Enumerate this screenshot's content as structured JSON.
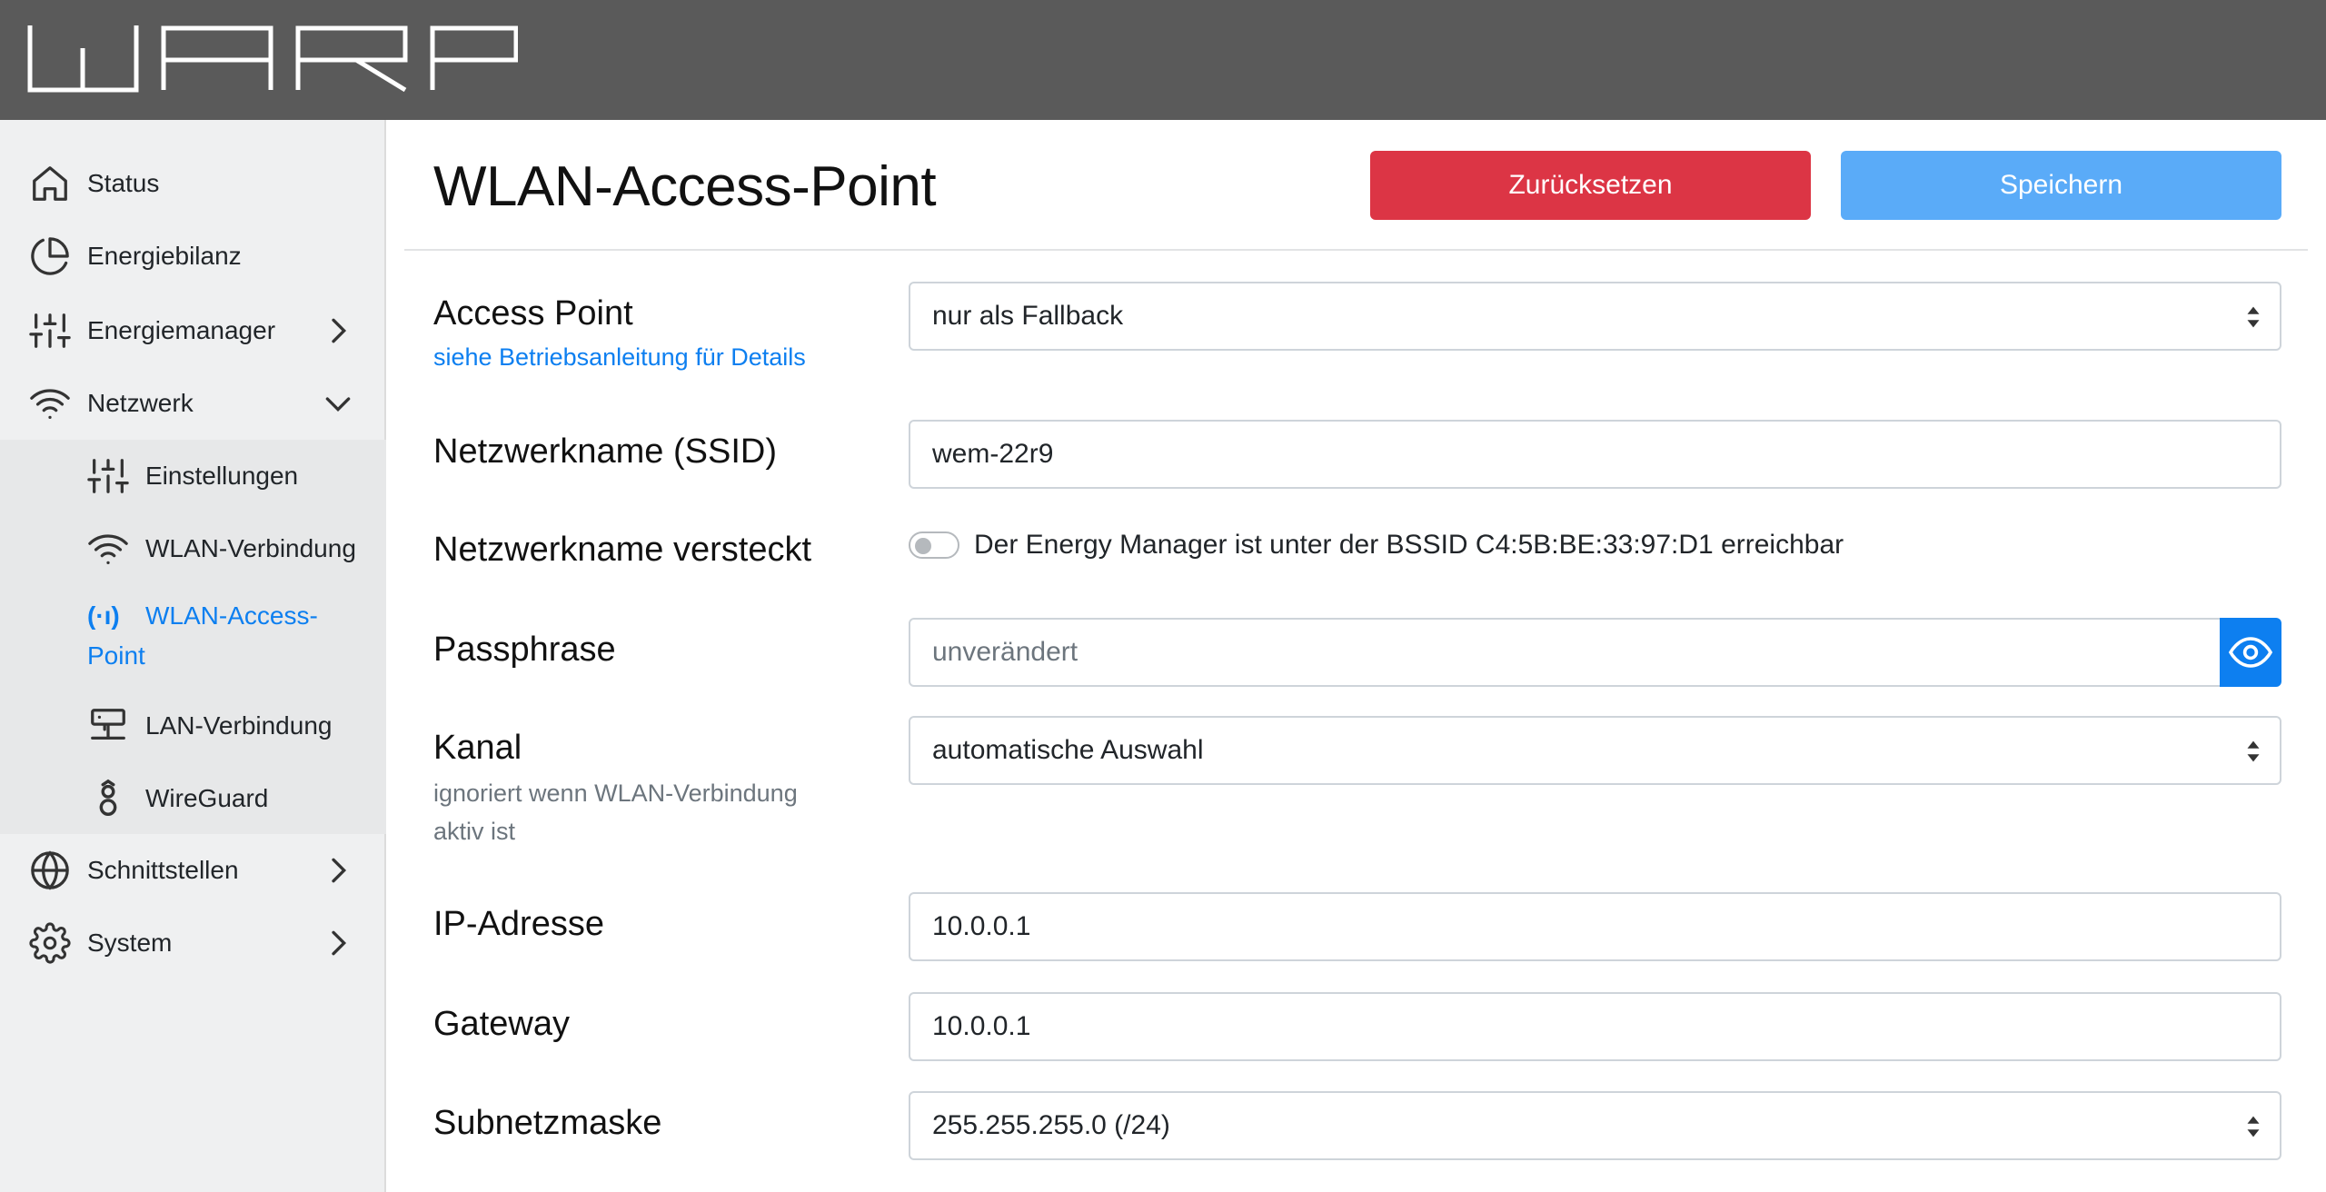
{
  "app": {
    "logo_text": "WARP"
  },
  "sidebar": {
    "items": [
      {
        "label": "Status",
        "icon": "home-icon"
      },
      {
        "label": "Energiebilanz",
        "icon": "pie-chart-icon"
      },
      {
        "label": "Energiemanager",
        "icon": "sliders-icon"
      },
      {
        "label": "Netzwerk",
        "icon": "wifi-icon"
      },
      {
        "label": "Schnittstellen",
        "icon": "globe-icon"
      },
      {
        "label": "System",
        "icon": "gear-icon"
      }
    ],
    "subitems": [
      {
        "label": "Einstellungen",
        "icon": "sliders-icon"
      },
      {
        "label": "WLAN-Verbindung",
        "icon": "wifi-icon"
      },
      {
        "label": "WLAN-Access-Point",
        "icon": "broadcast-icon",
        "indicator": "(·ı)"
      },
      {
        "label": "LAN-Verbindung",
        "icon": "server-icon"
      },
      {
        "label": "WireGuard",
        "icon": "wireguard-icon"
      }
    ]
  },
  "main": {
    "title": "WLAN-Access-Point",
    "reset_label": "Zurücksetzen",
    "save_label": "Speichern",
    "access_point": {
      "label": "Access Point",
      "link": "siehe Betriebsanleitung für Details",
      "value": "nur als Fallback"
    },
    "ssid": {
      "label": "Netzwerkname (SSID)",
      "value": "wem-22r9"
    },
    "hidden": {
      "label": "Netzwerkname versteckt",
      "text": "Der Energy Manager ist unter der BSSID C4:5B:BE:33:97:D1 erreichbar",
      "checked": false
    },
    "passphrase": {
      "label": "Passphrase",
      "placeholder": "unverändert"
    },
    "channel": {
      "label": "Kanal",
      "hint": "ignoriert wenn WLAN-Verbindung aktiv ist",
      "value": "automatische Auswahl"
    },
    "ip": {
      "label": "IP-Adresse",
      "value": "10.0.0.1"
    },
    "gateway": {
      "label": "Gateway",
      "value": "10.0.0.1"
    },
    "subnet": {
      "label": "Subnetzmaske",
      "value": "255.255.255.0 (/24)"
    }
  },
  "colors": {
    "topbar": "#5a5a5a",
    "accent": "#0d7ff0",
    "danger": "#dc3545",
    "save": "#5aabf8"
  }
}
